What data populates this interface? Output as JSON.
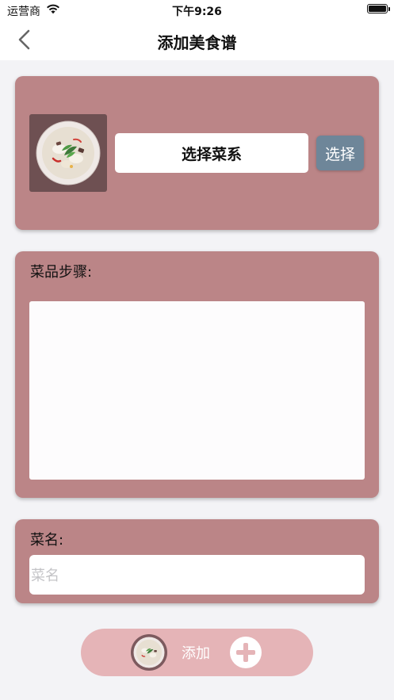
{
  "status_bar": {
    "carrier": "运营商",
    "time": "下午9:26"
  },
  "nav": {
    "title": "添加美食谱"
  },
  "cuisine": {
    "field_label": "选择菜系",
    "select_button": "选择"
  },
  "steps": {
    "label": "菜品步骤:",
    "value": ""
  },
  "dish_name": {
    "label": "菜名:",
    "placeholder": "菜名"
  },
  "add": {
    "label": "添加"
  },
  "colors": {
    "card": "#bb8587",
    "select_button": "#6e8699",
    "add_button": "#e5b4b7"
  },
  "icons": [
    "wifi-icon",
    "battery-icon",
    "back-chevron-icon",
    "dish-image",
    "plus-icon"
  ]
}
